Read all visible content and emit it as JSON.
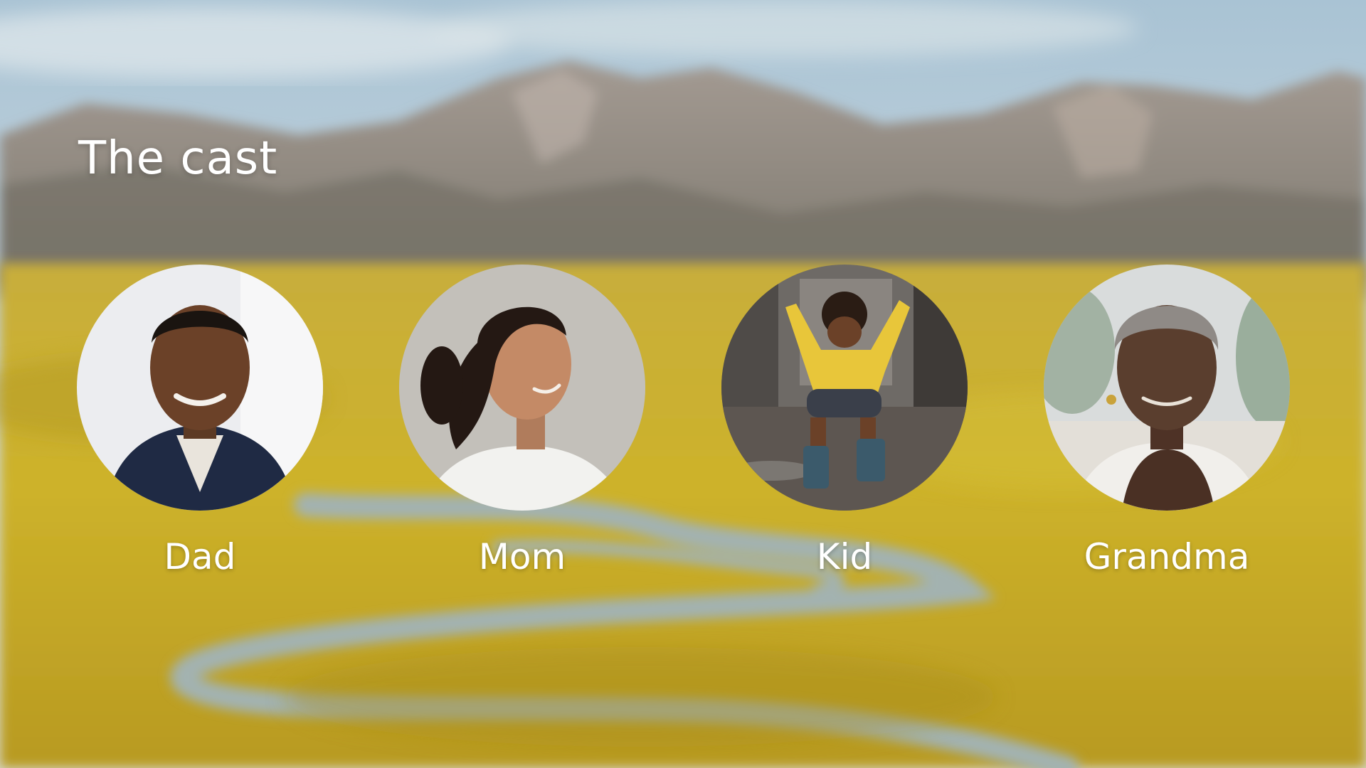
{
  "slide": {
    "title": "The cast",
    "background": {
      "icon": "mountain-valley-landscape",
      "sky_color": "#b9cdd9",
      "mountain_color": "#8f8a85",
      "meadow_color": "#c9ae2a",
      "river_color": "#9fb0b3"
    },
    "cast": [
      {
        "name": "Dad",
        "icon": "dad-portrait",
        "accent": "#1f2a44"
      },
      {
        "name": "Mom",
        "icon": "mom-portrait",
        "accent": "#f2f2ef"
      },
      {
        "name": "Kid",
        "icon": "kid-portrait",
        "accent": "#e8c63a"
      },
      {
        "name": "Grandma",
        "icon": "grandma-portrait",
        "accent": "#5a3e2e"
      }
    ]
  }
}
